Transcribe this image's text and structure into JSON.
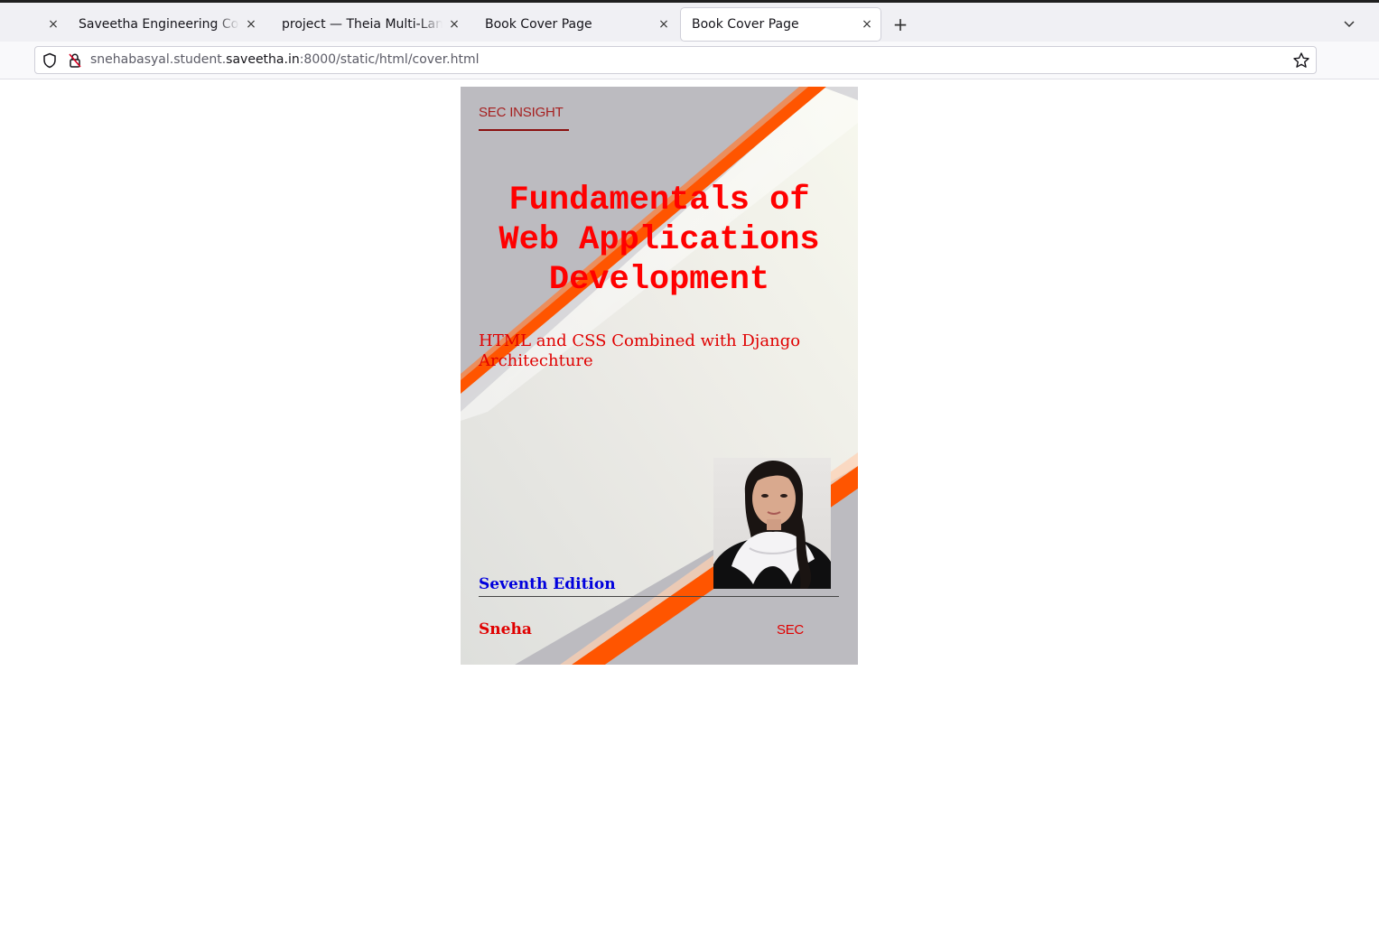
{
  "browser": {
    "tabs": [
      {
        "title": "Saveetha Engineering College",
        "active": false
      },
      {
        "title": "project — Theia Multi-Language",
        "active": false
      },
      {
        "title": "Book Cover Page",
        "active": false
      },
      {
        "title": "Book Cover Page",
        "active": true
      }
    ],
    "close_glyph": "×",
    "new_tab_glyph": "+",
    "tab_list_glyph": "⌵",
    "url_prefix": "snehabasyal.student.",
    "url_host": "saveetha.in",
    "url_suffix": ":8000/static/html/cover.html"
  },
  "cover": {
    "brand": "SEC INSIGHT",
    "title": "Fundamentals of Web Applications Development",
    "subtitle": "HTML and CSS Combined with Django Architechture",
    "edition": "Seventh Edition",
    "author": "Sneha",
    "publisher": "SEC",
    "colors": {
      "stripe": "#ff5500",
      "title": "#ff0000",
      "edition": "#0000dd",
      "background": "#bcbbc0"
    }
  }
}
